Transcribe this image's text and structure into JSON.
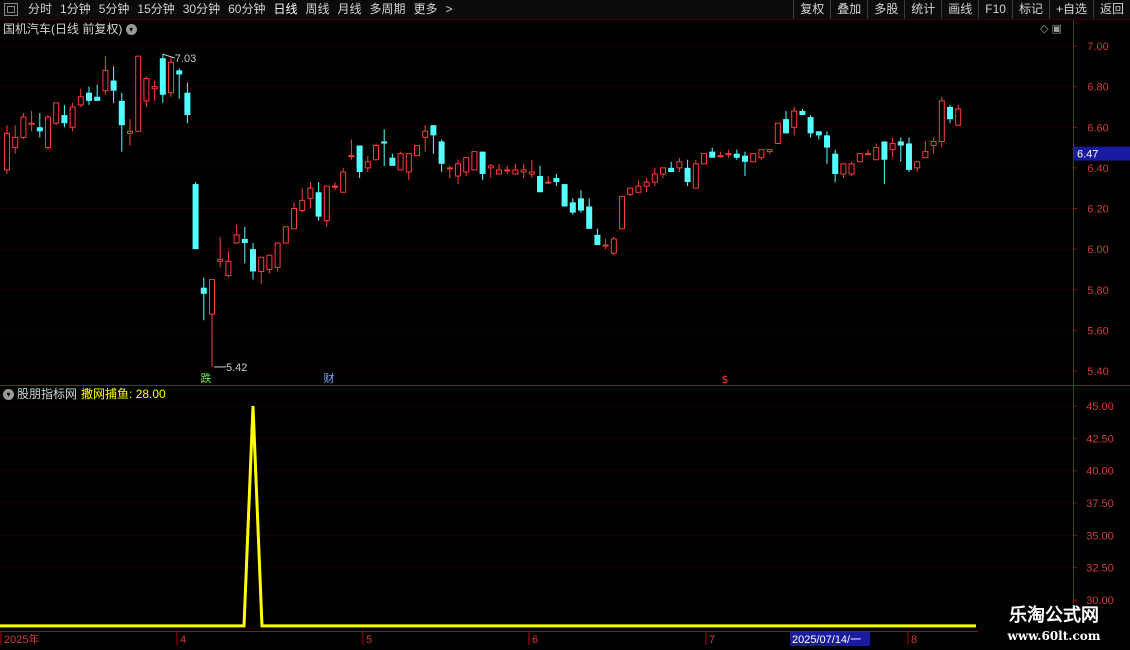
{
  "toolbar": {
    "periods": [
      "分时",
      "1分钟",
      "5分钟",
      "15分钟",
      "30分钟",
      "60分钟",
      "日线",
      "周线",
      "月线",
      "多周期",
      "更多"
    ],
    "active": "日线",
    "more_arrow": ">",
    "buttons": [
      "复权",
      "叠加",
      "多股",
      "统计",
      "画线",
      "F10",
      "标记",
      "+自选",
      "返回"
    ]
  },
  "stock_title": "国机汽车(日线 前复权)",
  "top_icons": "◇ ▣",
  "indicator": {
    "site": "股朋指标网",
    "line_name": "撒网捕鱼",
    "value": ": 28.00"
  },
  "watermark": {
    "line1": "乐淘公式网",
    "line2": "www.60lt.com"
  },
  "colors": {
    "up": "#ff3b3b",
    "down": "#54ffff",
    "axis": "#b40000",
    "grid": "#5a0000",
    "indicator": "#ffff00",
    "date_highlight": "#1a1aa0"
  },
  "chart_data": [
    {
      "type": "candlestick",
      "price_axis": {
        "min": 5.4,
        "max": 7.0,
        "ticks": [
          "7.00",
          "6.80",
          "6.60",
          "6.40",
          "6.20",
          "6.00",
          "5.80",
          "5.60",
          "5.40"
        ]
      },
      "current_price": "6.47",
      "annotations": {
        "high": "7.03",
        "low": "5.42",
        "markers": [
          "跌",
          "财",
          "$"
        ]
      },
      "candles": [
        [
          6.39,
          6.61,
          6.37,
          6.57
        ],
        [
          6.5,
          6.61,
          6.47,
          6.55
        ],
        [
          6.55,
          6.67,
          6.54,
          6.65
        ],
        [
          6.62,
          6.68,
          6.58,
          6.62
        ],
        [
          6.6,
          6.67,
          6.55,
          6.58
        ],
        [
          6.5,
          6.66,
          6.49,
          6.65
        ],
        [
          6.62,
          6.72,
          6.61,
          6.72
        ],
        [
          6.66,
          6.71,
          6.6,
          6.62
        ],
        [
          6.6,
          6.72,
          6.58,
          6.7
        ],
        [
          6.71,
          6.79,
          6.7,
          6.75
        ],
        [
          6.77,
          6.8,
          6.71,
          6.73
        ],
        [
          6.75,
          6.81,
          6.73,
          6.73
        ],
        [
          6.78,
          6.95,
          6.76,
          6.88
        ],
        [
          6.83,
          6.9,
          6.72,
          6.78
        ],
        [
          6.73,
          6.77,
          6.48,
          6.61
        ],
        [
          6.57,
          6.64,
          6.51,
          6.58
        ],
        [
          6.58,
          6.95,
          6.58,
          6.95
        ],
        [
          6.73,
          6.85,
          6.7,
          6.84
        ],
        [
          6.79,
          6.83,
          6.73,
          6.8
        ],
        [
          6.94,
          6.96,
          6.72,
          6.76
        ],
        [
          6.77,
          6.95,
          6.75,
          6.92
        ],
        [
          6.88,
          6.89,
          6.74,
          6.86
        ],
        [
          6.77,
          6.82,
          6.62,
          6.66
        ],
        [
          6.32,
          6.33,
          6.0,
          6.0
        ],
        [
          5.81,
          5.86,
          5.65,
          5.78
        ],
        [
          5.68,
          5.85,
          5.42,
          5.85
        ],
        [
          5.94,
          6.06,
          5.91,
          5.95
        ],
        [
          5.87,
          5.99,
          5.86,
          5.94
        ],
        [
          6.03,
          6.12,
          6.03,
          6.07
        ],
        [
          6.05,
          6.11,
          5.93,
          6.03
        ],
        [
          6.0,
          6.03,
          5.85,
          5.89
        ],
        [
          5.89,
          5.95,
          5.83,
          5.96
        ],
        [
          5.9,
          5.95,
          5.88,
          5.97
        ],
        [
          5.91,
          6.01,
          5.89,
          6.03
        ],
        [
          6.03,
          6.11,
          6.03,
          6.11
        ],
        [
          6.1,
          6.23,
          6.1,
          6.2
        ],
        [
          6.19,
          6.3,
          6.18,
          6.24
        ],
        [
          6.25,
          6.33,
          6.2,
          6.3
        ],
        [
          6.28,
          6.33,
          6.14,
          6.16
        ],
        [
          6.14,
          6.31,
          6.11,
          6.31
        ],
        [
          6.31,
          6.33,
          6.29,
          6.31
        ],
        [
          6.28,
          6.4,
          6.28,
          6.38
        ],
        [
          6.46,
          6.54,
          6.44,
          6.46
        ],
        [
          6.51,
          6.51,
          6.35,
          6.38
        ],
        [
          6.4,
          6.46,
          6.38,
          6.43
        ],
        [
          6.44,
          6.52,
          6.44,
          6.51
        ],
        [
          6.53,
          6.59,
          6.41,
          6.52
        ],
        [
          6.45,
          6.47,
          6.42,
          6.41
        ],
        [
          6.39,
          6.48,
          6.39,
          6.47
        ],
        [
          6.38,
          6.42,
          6.34,
          6.47
        ],
        [
          6.46,
          6.51,
          6.46,
          6.51
        ],
        [
          6.55,
          6.61,
          6.48,
          6.58
        ],
        [
          6.61,
          6.61,
          6.47,
          6.56
        ],
        [
          6.53,
          6.54,
          6.38,
          6.42
        ],
        [
          6.4,
          6.41,
          6.35,
          6.4
        ],
        [
          6.36,
          6.44,
          6.32,
          6.42
        ],
        [
          6.38,
          6.43,
          6.36,
          6.45
        ],
        [
          6.39,
          6.44,
          6.4,
          6.48
        ],
        [
          6.48,
          6.48,
          6.34,
          6.37
        ],
        [
          6.4,
          6.42,
          6.35,
          6.41
        ],
        [
          6.37,
          6.42,
          6.38,
          6.39
        ],
        [
          6.39,
          6.41,
          6.37,
          6.39
        ],
        [
          6.37,
          6.42,
          6.39,
          6.39
        ],
        [
          6.38,
          6.42,
          6.35,
          6.39
        ],
        [
          6.37,
          6.44,
          6.35,
          6.38
        ],
        [
          6.36,
          6.41,
          6.29,
          6.28
        ],
        [
          6.33,
          6.36,
          6.32,
          6.33
        ],
        [
          6.35,
          6.37,
          6.31,
          6.33
        ],
        [
          6.32,
          6.32,
          6.22,
          6.21
        ],
        [
          6.23,
          6.25,
          6.17,
          6.18
        ],
        [
          6.25,
          6.29,
          6.18,
          6.19
        ],
        [
          6.21,
          6.25,
          6.1,
          6.1
        ],
        [
          6.07,
          6.1,
          6.04,
          6.02
        ],
        [
          6.02,
          6.05,
          6.0,
          6.02
        ],
        [
          5.98,
          6.06,
          5.97,
          6.05
        ],
        [
          6.1,
          6.26,
          6.1,
          6.26
        ],
        [
          6.27,
          6.3,
          6.26,
          6.3
        ],
        [
          6.28,
          6.34,
          6.28,
          6.31
        ],
        [
          6.31,
          6.35,
          6.28,
          6.33
        ],
        [
          6.33,
          6.4,
          6.31,
          6.37
        ],
        [
          6.37,
          6.4,
          6.35,
          6.4
        ],
        [
          6.4,
          6.43,
          6.38,
          6.38
        ],
        [
          6.4,
          6.45,
          6.38,
          6.43
        ],
        [
          6.4,
          6.44,
          6.31,
          6.33
        ],
        [
          6.3,
          6.44,
          6.3,
          6.42
        ],
        [
          6.42,
          6.47,
          6.42,
          6.47
        ],
        [
          6.48,
          6.5,
          6.45,
          6.45
        ],
        [
          6.46,
          6.48,
          6.45,
          6.46
        ],
        [
          6.47,
          6.49,
          6.45,
          6.47
        ],
        [
          6.47,
          6.49,
          6.44,
          6.45
        ],
        [
          6.46,
          6.48,
          6.36,
          6.43
        ],
        [
          6.43,
          6.47,
          6.43,
          6.47
        ],
        [
          6.45,
          6.48,
          6.44,
          6.49
        ],
        [
          6.48,
          6.49,
          6.47,
          6.49
        ],
        [
          6.52,
          6.62,
          6.52,
          6.62
        ],
        [
          6.64,
          6.68,
          6.57,
          6.57
        ],
        [
          6.6,
          6.7,
          6.56,
          6.68
        ],
        [
          6.68,
          6.69,
          6.66,
          6.66
        ],
        [
          6.65,
          6.66,
          6.55,
          6.57
        ],
        [
          6.58,
          6.58,
          6.54,
          6.56
        ],
        [
          6.56,
          6.58,
          6.42,
          6.5
        ],
        [
          6.47,
          6.49,
          6.33,
          6.37
        ],
        [
          6.37,
          6.42,
          6.35,
          6.42
        ],
        [
          6.37,
          6.43,
          6.36,
          6.42
        ],
        [
          6.43,
          6.47,
          6.43,
          6.47
        ],
        [
          6.47,
          6.49,
          6.47,
          6.47
        ],
        [
          6.44,
          6.52,
          6.44,
          6.5
        ],
        [
          6.53,
          6.53,
          6.32,
          6.44
        ],
        [
          6.49,
          6.55,
          6.45,
          6.52
        ],
        [
          6.53,
          6.55,
          6.43,
          6.51
        ],
        [
          6.52,
          6.55,
          6.38,
          6.39
        ],
        [
          6.4,
          6.43,
          6.38,
          6.43
        ],
        [
          6.45,
          6.53,
          6.45,
          6.48
        ],
        [
          6.51,
          6.55,
          6.47,
          6.53
        ],
        [
          6.53,
          6.75,
          6.5,
          6.73
        ],
        [
          6.7,
          6.71,
          6.62,
          6.64
        ],
        [
          6.61,
          6.71,
          6.61,
          6.69
        ]
      ]
    },
    {
      "type": "line",
      "name": "撒网捕鱼",
      "value_axis": {
        "min": 30.0,
        "max": 45.0,
        "ticks": [
          "45.00",
          "42.50",
          "40.00",
          "37.50",
          "35.00",
          "32.50",
          "30.00"
        ]
      },
      "baseline": 28.0,
      "spike": {
        "index": 30,
        "value": 45.0
      },
      "x_labels": [
        "2025年",
        "4",
        "5",
        "6",
        "7",
        "2025/07/14/一",
        "8"
      ]
    }
  ]
}
